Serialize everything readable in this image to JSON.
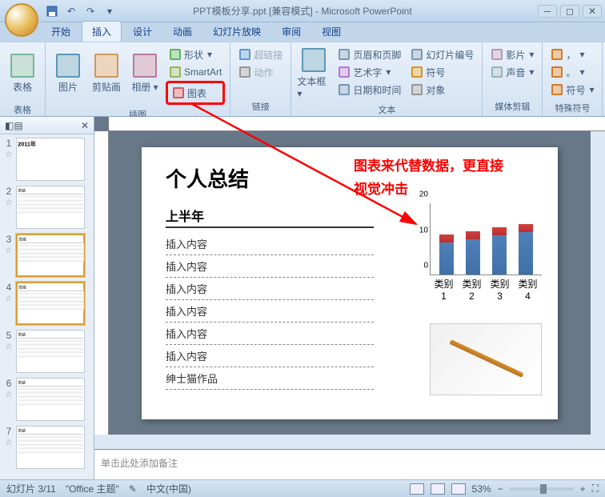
{
  "title": "PPT模板分享.ppt [兼容模式] - Microsoft PowerPoint",
  "tabs": [
    "开始",
    "插入",
    "设计",
    "动画",
    "幻灯片放映",
    "审阅",
    "视图"
  ],
  "activeTab": 1,
  "ribbon": {
    "groups": [
      {
        "label": "表格",
        "items": [
          {
            "type": "big",
            "label": "表格",
            "icon": "table"
          }
        ]
      },
      {
        "label": "插图",
        "items": [
          {
            "type": "big",
            "label": "图片",
            "icon": "picture"
          },
          {
            "type": "big",
            "label": "剪贴画",
            "icon": "clipart"
          },
          {
            "type": "big",
            "label": "相册",
            "icon": "album",
            "dd": true
          },
          {
            "type": "col",
            "sub": [
              {
                "label": "形状",
                "icon": "shapes",
                "dd": true
              },
              {
                "label": "SmartArt",
                "icon": "smartart"
              },
              {
                "label": "图表",
                "icon": "chart",
                "highlight": true
              }
            ]
          }
        ]
      },
      {
        "label": "链接",
        "items": [
          {
            "type": "col",
            "sub": [
              {
                "label": "超链接",
                "icon": "hyperlink",
                "disabled": true
              },
              {
                "label": "动作",
                "icon": "action",
                "disabled": true
              }
            ]
          }
        ]
      },
      {
        "label": "文本",
        "items": [
          {
            "type": "big",
            "label": "文本框",
            "icon": "textbox",
            "dd": true
          },
          {
            "type": "col",
            "sub": [
              {
                "label": "页眉和页脚",
                "icon": "header"
              },
              {
                "label": "艺术字",
                "icon": "wordart",
                "dd": true
              },
              {
                "label": "日期和时间",
                "icon": "datetime"
              }
            ]
          },
          {
            "type": "col",
            "sub": [
              {
                "label": "幻灯片编号",
                "icon": "slidenum"
              },
              {
                "label": "符号",
                "icon": "symbol"
              },
              {
                "label": "对象",
                "icon": "object"
              }
            ]
          }
        ]
      },
      {
        "label": "媒体剪辑",
        "items": [
          {
            "type": "col",
            "sub": [
              {
                "label": "影片",
                "icon": "movie",
                "dd": true
              },
              {
                "label": "声音",
                "icon": "sound",
                "dd": true
              }
            ]
          }
        ]
      },
      {
        "label": "特殊符号",
        "items": [
          {
            "type": "col",
            "sub": [
              {
                "label": "，",
                "icon": "comma",
                "dd": true
              },
              {
                "label": "。",
                "icon": "period",
                "dd": true
              },
              {
                "label": "符号",
                "icon": "symbols",
                "dd": true
              }
            ]
          }
        ]
      }
    ]
  },
  "slide": {
    "title": "个人总结",
    "section": "上半年",
    "items": [
      "插入内容",
      "插入内容",
      "插入内容",
      "插入内容",
      "插入内容",
      "插入内容",
      "绅士猫作品"
    ]
  },
  "chart_data": {
    "type": "bar",
    "categories": [
      "类别 1",
      "类别 2",
      "类别 3",
      "类别 4"
    ],
    "values": [
      9,
      10,
      11,
      12
    ],
    "ylim": [
      0,
      20
    ],
    "yticks": [
      0,
      10,
      20
    ]
  },
  "annotations": {
    "line1": "图表来代替数据，更直接",
    "line2": "视觉冲击"
  },
  "notes": "单击此处添加备注",
  "status": {
    "slide": "幻灯片 3/11",
    "theme": "\"Office 主题\"",
    "lang": "中文(中国)",
    "zoom": "53%"
  },
  "thumbs": {
    "count": 7,
    "selected": [
      3,
      4
    ],
    "thumb1": "2011年",
    "thumbLabel": "总结"
  }
}
